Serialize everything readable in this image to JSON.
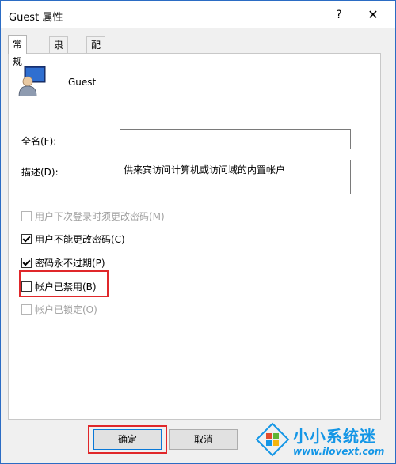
{
  "window": {
    "title": "Guest 属性",
    "help_glyph": "?",
    "close_glyph": "✕"
  },
  "tabs": [
    {
      "label": "常规",
      "active": true
    },
    {
      "label": "隶属于",
      "active": false
    },
    {
      "label": "配置文件",
      "active": false
    }
  ],
  "user": {
    "name": "Guest",
    "icon": "user-account-icon"
  },
  "fields": {
    "full_name": {
      "label": "全名(F):",
      "value": ""
    },
    "description": {
      "label": "描述(D):",
      "value": "供来宾访问计算机或访问域的内置帐户"
    }
  },
  "checkboxes": [
    {
      "label": "用户下次登录时须更改密码(M)",
      "checked": false,
      "disabled": true
    },
    {
      "label": "用户不能更改密码(C)",
      "checked": true,
      "disabled": false
    },
    {
      "label": "密码永不过期(P)",
      "checked": true,
      "disabled": false
    },
    {
      "label": "帐户已禁用(B)",
      "checked": false,
      "disabled": false
    },
    {
      "label": "帐户已锁定(O)",
      "checked": false,
      "disabled": true
    }
  ],
  "buttons": {
    "ok": "确定",
    "cancel": "取消"
  },
  "watermark": {
    "title": "小小系统迷",
    "url": "www.ilovext.com"
  },
  "colors": {
    "highlight": "#e0272a",
    "accent": "#0a78d7",
    "watermark": "#1496e6"
  }
}
